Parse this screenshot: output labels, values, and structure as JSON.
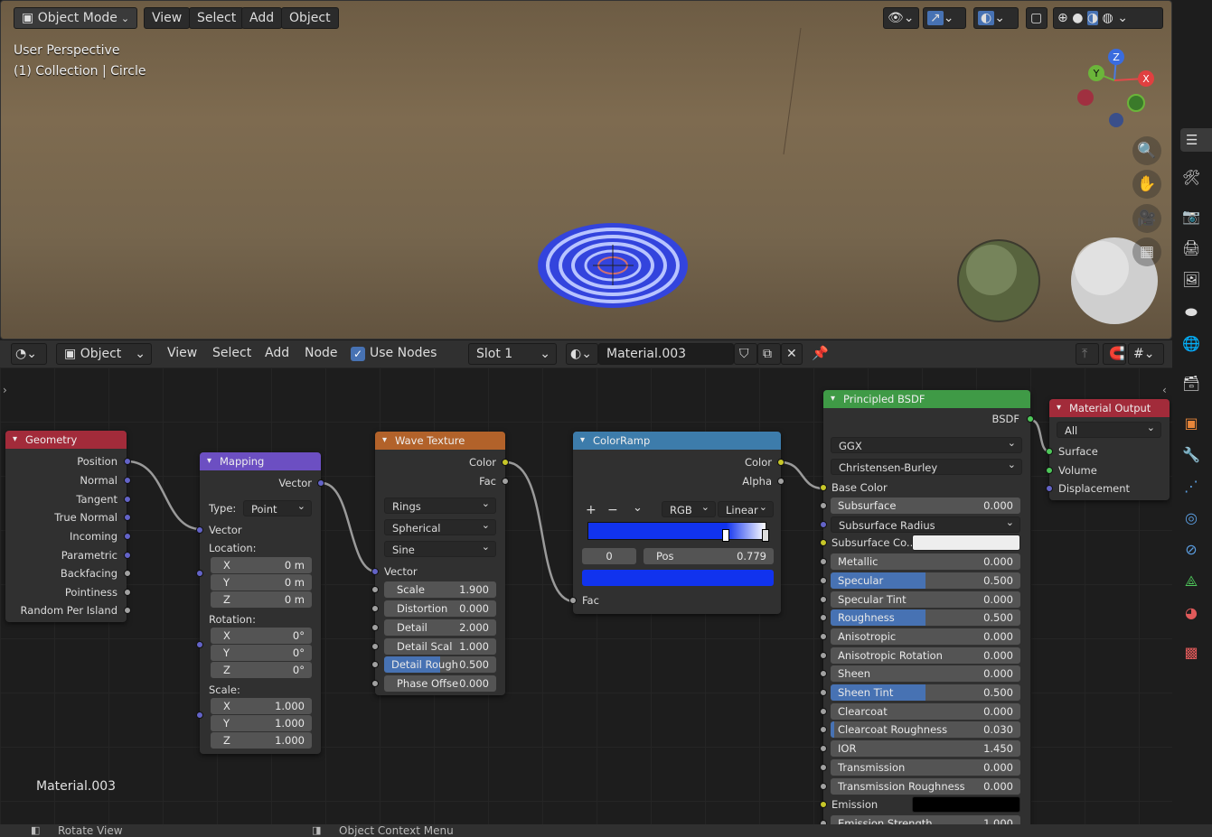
{
  "viewport": {
    "mode": "Object Mode",
    "menu": [
      "View",
      "Select",
      "Add",
      "Object"
    ],
    "overlay_line1": "User Perspective",
    "overlay_line2": "(1) Collection | Circle",
    "gizmo": {
      "z": "Z",
      "y": "Y",
      "x": "X"
    }
  },
  "node_editor": {
    "editor_type": "Object",
    "menu": [
      "View",
      "Select",
      "Add",
      "Node"
    ],
    "use_nodes_label": "Use Nodes",
    "use_nodes_checked": true,
    "slot": "Slot 1",
    "material": "Material.003",
    "material_label": "Material.003"
  },
  "nodes": {
    "geometry": {
      "title": "Geometry",
      "outputs": [
        "Position",
        "Normal",
        "Tangent",
        "True Normal",
        "Incoming",
        "Parametric",
        "Backfacing",
        "Pointiness",
        "Random Per Island"
      ]
    },
    "mapping": {
      "title": "Mapping",
      "output": "Vector",
      "type_label": "Type:",
      "type_value": "Point",
      "input_vector": "Vector",
      "location_label": "Location:",
      "location": [
        {
          "axis": "X",
          "value": "0 m"
        },
        {
          "axis": "Y",
          "value": "0 m"
        },
        {
          "axis": "Z",
          "value": "0 m"
        }
      ],
      "rotation_label": "Rotation:",
      "rotation": [
        {
          "axis": "X",
          "value": "0°"
        },
        {
          "axis": "Y",
          "value": "0°"
        },
        {
          "axis": "Z",
          "value": "0°"
        }
      ],
      "scale_label": "Scale:",
      "scale": [
        {
          "axis": "X",
          "value": "1.000"
        },
        {
          "axis": "Y",
          "value": "1.000"
        },
        {
          "axis": "Z",
          "value": "1.000"
        }
      ]
    },
    "wave": {
      "title": "Wave Texture",
      "outputs": [
        "Color",
        "Fac"
      ],
      "dropdowns": [
        "Rings",
        "Spherical",
        "Sine"
      ],
      "input_vector": "Vector",
      "fields": [
        {
          "label": "Scale",
          "value": "1.900"
        },
        {
          "label": "Distortion",
          "value": "0.000"
        },
        {
          "label": "Detail",
          "value": "2.000"
        },
        {
          "label": "Detail Scal",
          "value": "1.000"
        },
        {
          "label": "Detail Rough",
          "value": "0.500",
          "fill": 0.5
        },
        {
          "label": "Phase Offse",
          "value": "0.000"
        }
      ]
    },
    "colorramp": {
      "title": "ColorRamp",
      "outputs": [
        "Color",
        "Alpha"
      ],
      "mode": "RGB",
      "interp": "Linear",
      "index": "0",
      "pos_label": "Pos",
      "pos_value": "0.779",
      "color_start": "#1133ee",
      "color_end": "#ffffff",
      "input_fac": "Fac"
    },
    "bsdf": {
      "title": "Principled BSDF",
      "output": "BSDF",
      "distribution": "GGX",
      "subsurface_method": "Christensen-Burley",
      "base_color_label": "Base Color",
      "fields": [
        {
          "label": "Subsurface",
          "value": "0.000"
        },
        {
          "label": "Subsurface Radius",
          "value": "",
          "dropdown": true
        },
        {
          "label": "Subsurface Co...",
          "value": "",
          "color": "#eeeeee"
        },
        {
          "label": "Metallic",
          "value": "0.000"
        },
        {
          "label": "Specular",
          "value": "0.500",
          "fill": 0.5
        },
        {
          "label": "Specular Tint",
          "value": "0.000"
        },
        {
          "label": "Roughness",
          "value": "0.500",
          "fill": 0.5
        },
        {
          "label": "Anisotropic",
          "value": "0.000"
        },
        {
          "label": "Anisotropic Rotation",
          "value": "0.000"
        },
        {
          "label": "Sheen",
          "value": "0.000"
        },
        {
          "label": "Sheen Tint",
          "value": "0.500",
          "fill": 0.5
        },
        {
          "label": "Clearcoat",
          "value": "0.000"
        },
        {
          "label": "Clearcoat Roughness",
          "value": "0.030",
          "fill": 0.03
        },
        {
          "label": "IOR",
          "value": "1.450"
        },
        {
          "label": "Transmission",
          "value": "0.000"
        },
        {
          "label": "Transmission Roughness",
          "value": "0.000"
        },
        {
          "label": "Emission",
          "value": "",
          "color": "#000000"
        },
        {
          "label": "Emission Strength",
          "value": "1.000"
        }
      ]
    },
    "output": {
      "title": "Material Output",
      "target": "All",
      "inputs": [
        "Surface",
        "Volume",
        "Displacement"
      ]
    }
  },
  "status": {
    "left": "Rotate View",
    "right": "Object Context Menu"
  }
}
